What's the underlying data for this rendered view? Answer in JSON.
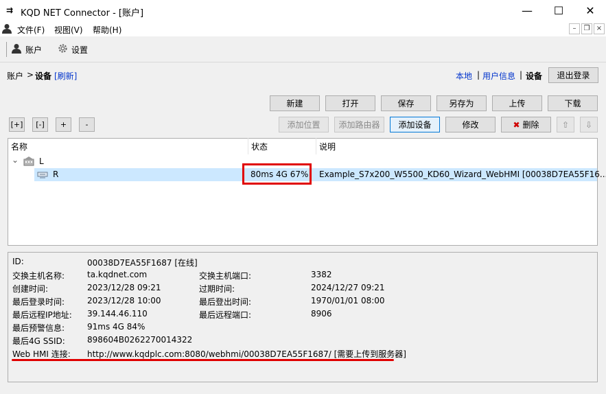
{
  "window": {
    "title": "KQD NET Connector - [账户]",
    "app_icon": "⇉",
    "minimize_glyph": "—",
    "maximize_glyph": "☐",
    "close_glyph": "✕"
  },
  "menu": {
    "items": [
      "文件(F)",
      "视图(V)",
      "帮助(H)"
    ],
    "mdi_minimize": "–",
    "mdi_restore": "❐",
    "mdi_close": "×"
  },
  "toolbar": {
    "account_label": "账户",
    "settings_label": "设置"
  },
  "breadcrumb": {
    "root": "账户",
    "sep": ">",
    "current": "设备",
    "refresh": "[刷新]"
  },
  "nav": {
    "local": "本地",
    "sep1": "|",
    "user_info": "用户信息",
    "sep2": "|",
    "device": "设备",
    "logout": "退出登录"
  },
  "actions": [
    "新建",
    "打开",
    "保存",
    "另存为",
    "上传",
    "下载"
  ],
  "small_buttons": [
    "[+]",
    "[-]",
    "+",
    "-"
  ],
  "device_buttons": {
    "add_location": "添加位置",
    "add_router": "添加路由器",
    "add_device": "添加设备",
    "modify": "修改",
    "delete": "删除",
    "delete_icon": "✖",
    "move_up": "⇧",
    "move_down": "⇩"
  },
  "table": {
    "columns": [
      "名称",
      "状态",
      "说明"
    ],
    "group": {
      "toggle": "⌄",
      "name": "L"
    },
    "row": {
      "name": "R",
      "status": "80ms 4G 67%",
      "description": "Example_S7x200_W5500_KD60_Wizard_WebHMI [00038D7EA55F16..."
    }
  },
  "info": {
    "id_label": "ID:",
    "id_value": "00038D7EA55F1687 [在线]",
    "switch_host_label": "交换主机名称:",
    "switch_host_value": "ta.kqdnet.com",
    "switch_port_label": "交换主机端口:",
    "switch_port_value": "3382",
    "created_label": "创建时间:",
    "created_value": "2023/12/28 09:21",
    "expire_label": "过期时间:",
    "expire_value": "2024/12/27 09:21",
    "last_login_label": "最后登录时间:",
    "last_login_value": "2023/12/28 10:00",
    "last_logout_label": "最后登出时间:",
    "last_logout_value": "1970/01/01 08:00",
    "remote_ip_label": "最后远程IP地址:",
    "remote_ip_value": "39.144.46.110",
    "remote_port_label": "最后远程端口:",
    "remote_port_value": "8906",
    "warning_label": "最后预警信息:",
    "warning_value": "91ms 4G 84%",
    "ssid_label": "最后4G SSID:",
    "ssid_value": "898604B0262270014322",
    "webhmi_label": "Web HMI 连接:",
    "webhmi_value": "http://www.kqdplc.com:8080/webhmi/00038D7EA55F1687/ [需要上传到服务器]"
  },
  "colors": {
    "link": "#0033cc",
    "highlight": "#e00000",
    "selection": "#cce8ff"
  }
}
